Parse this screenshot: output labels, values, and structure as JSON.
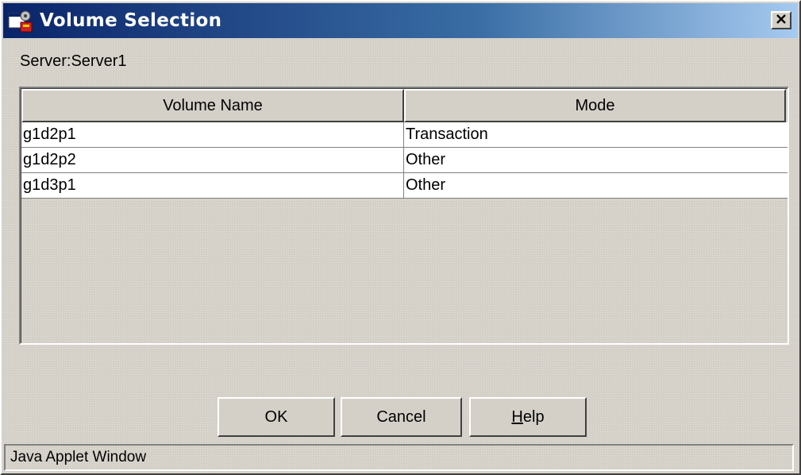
{
  "window": {
    "title": "Volume Selection",
    "close_symbol": "×",
    "title_icon": "app-window-icon",
    "close_icon": "close-icon"
  },
  "server_label": "Server:Server1",
  "table": {
    "columns": [
      "Volume Name",
      "Mode"
    ],
    "rows": [
      {
        "volume": "g1d2p1",
        "mode": "Transaction"
      },
      {
        "volume": "g1d2p2",
        "mode": "Other"
      },
      {
        "volume": "g1d3p1",
        "mode": "Other"
      }
    ]
  },
  "buttons": {
    "ok": "OK",
    "cancel": "Cancel",
    "help_mnemonic": "H",
    "help_rest": "elp"
  },
  "status": "Java Applet Window",
  "colors": {
    "title_gradient_start": "#0a246a",
    "title_gradient_end": "#a6caf0",
    "window_bg": "#d4d0c8"
  }
}
